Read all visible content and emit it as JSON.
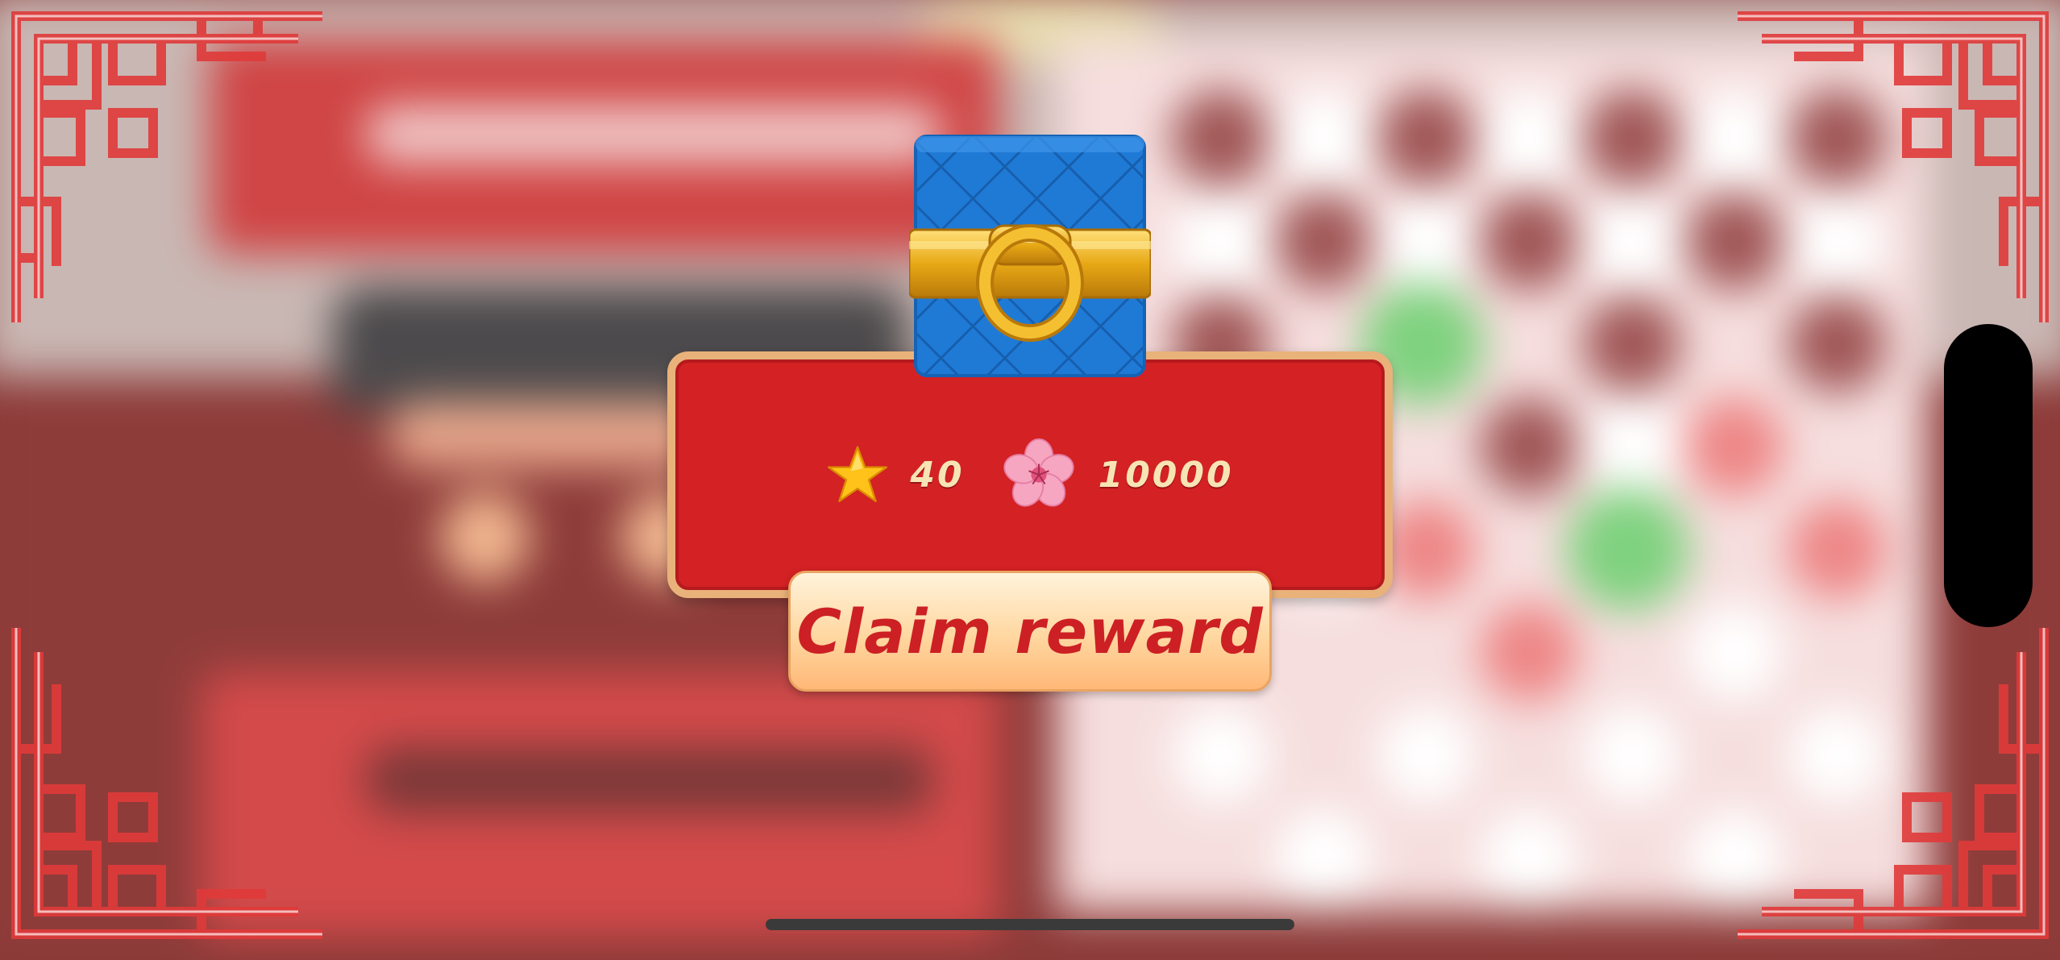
{
  "reward": {
    "items": [
      {
        "icon": "star-icon",
        "value": "40"
      },
      {
        "icon": "cherry-blossom-icon",
        "value": "10000"
      }
    ]
  },
  "claim_button": {
    "label": "Claim reward"
  },
  "colors": {
    "panel_red": "#d42124",
    "panel_border": "#e9b27a",
    "button_text": "#cc2024",
    "value_text": "#f7e4b5",
    "chest_blue": "#1f7ad6",
    "chest_gold": "#e2a514"
  },
  "decor": {
    "chest_icon": "treasure-chest-icon",
    "corner_ornament": "chinese-lattice-corner"
  }
}
